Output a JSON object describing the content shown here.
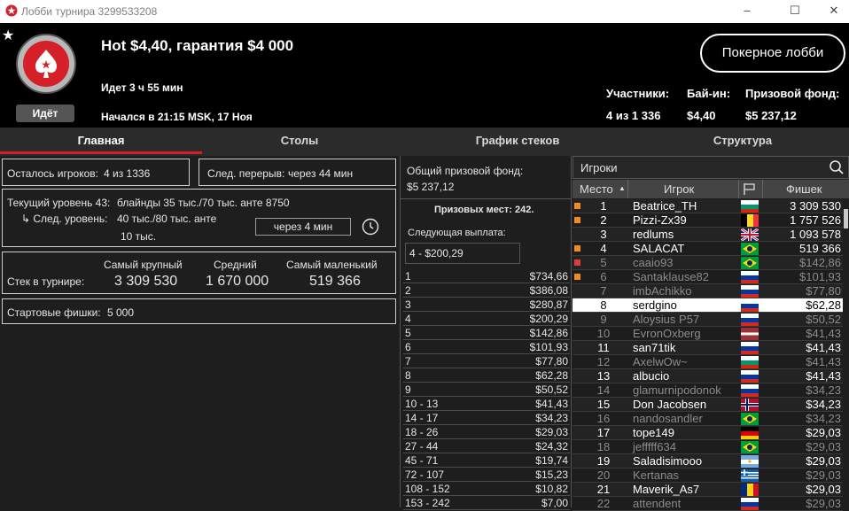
{
  "window": {
    "title": "Лобби турнира 3299533208",
    "minimize": "–",
    "maximize": "☐",
    "close": "✕"
  },
  "header": {
    "favorite_icon": "★",
    "tournament_name": "Hot $4,40, гарантия $4 000",
    "status": "Идёт",
    "running_time": "Идет 3 ч 55 мин",
    "started": "Начался в 21:15 MSK, 17 Ноя",
    "poker_lobby_button": "Покерное лобби",
    "stats": {
      "participants_label": "Участники:",
      "participants_value": "4 из 1 336",
      "buyin_label": "Бай-ин:",
      "buyin_value": "$4,40",
      "prize_label": "Призовой фонд:",
      "prize_value": "$5 237,12"
    }
  },
  "tabs": [
    "Главная",
    "Столы",
    "График стеков",
    "Структура"
  ],
  "info": {
    "players_left_label": "Осталось игроков:",
    "players_left_value": "4 из 1336",
    "next_break_label": "След. перерыв:",
    "next_break_value": "через 44 мин",
    "current_level_label": "Текущий уровень 43:",
    "current_level_value": "блайнды 35 тыс./70 тыс. анте 8750",
    "next_level_label": "↳  След. уровень:",
    "next_level_value_1": "40 тыс./80 тыс. анте",
    "next_level_value_2": "10 тыс.",
    "next_level_in": "через 4 мин",
    "stack_label": "Стек в турнире:",
    "largest_label": "Самый крупный",
    "largest_value": "3 309 530",
    "average_label": "Средний",
    "average_value": "1 670 000",
    "smallest_label": "Самый маленький",
    "smallest_value": "519 366",
    "starting_chips_label": "Стартовые фишки:",
    "starting_chips_value": "5 000"
  },
  "prize": {
    "pool_label": "Общий призовой фонд:",
    "pool_value": "$5 237,12",
    "places_label": "Призовых мест: 242.",
    "next_payout_label": "Следующая выплата:",
    "next_payout_value": "4 - $200,29",
    "payouts": [
      {
        "place": "1",
        "amount": "$734,66"
      },
      {
        "place": "2",
        "amount": "$386,08"
      },
      {
        "place": "3",
        "amount": "$280,87"
      },
      {
        "place": "4",
        "amount": "$200,29"
      },
      {
        "place": "5",
        "amount": "$142,86"
      },
      {
        "place": "6",
        "amount": "$101,93"
      },
      {
        "place": "7",
        "amount": "$77,80"
      },
      {
        "place": "8",
        "amount": "$62,28"
      },
      {
        "place": "9",
        "amount": "$50,52"
      },
      {
        "place": "10 - 13",
        "amount": "$41,43"
      },
      {
        "place": "14 - 17",
        "amount": "$34,23"
      },
      {
        "place": "18 - 26",
        "amount": "$29,03"
      },
      {
        "place": "27 - 44",
        "amount": "$24,32"
      },
      {
        "place": "45 - 71",
        "amount": "$19,74"
      },
      {
        "place": "72 - 107",
        "amount": "$15,23"
      },
      {
        "place": "108 - 152",
        "amount": "$10,82"
      },
      {
        "place": "153 - 242",
        "amount": "$7,00"
      }
    ]
  },
  "players": {
    "search_label": "Игроки",
    "col_place": "Место",
    "col_player": "Игрок",
    "col_chips": "Фишек",
    "sort_icon": "▲",
    "flag_col_icon": "flag-icon",
    "rows": [
      {
        "rank": "1",
        "name": "Beatrice_TH",
        "chips": "3 309 530",
        "flag": "bg",
        "marker": "#f08a24",
        "active": true
      },
      {
        "rank": "2",
        "name": "Pizzi-Zx39",
        "chips": "1 757 526",
        "flag": "be",
        "marker": "#f08a24",
        "active": true
      },
      {
        "rank": "3",
        "name": "redlums",
        "chips": "1 093 578",
        "flag": "gb",
        "marker": "",
        "active": true
      },
      {
        "rank": "4",
        "name": "SALACAT",
        "chips": "519 366",
        "flag": "br",
        "marker": "#f08a24",
        "active": true
      },
      {
        "rank": "5",
        "name": "caaio93",
        "chips": "$142,86",
        "flag": "br",
        "marker": "#e03c3c",
        "active": false
      },
      {
        "rank": "6",
        "name": "Santaklause82",
        "chips": "$101,93",
        "flag": "ru",
        "marker": "#f08a24",
        "active": false
      },
      {
        "rank": "7",
        "name": "imbAchikko",
        "chips": "$77,80",
        "flag": "ru",
        "marker": "",
        "active": false
      },
      {
        "rank": "8",
        "name": "serdgino",
        "chips": "$62,28",
        "flag": "ru",
        "marker": "",
        "active": true,
        "highlight": true
      },
      {
        "rank": "9",
        "name": "Aloysius P57",
        "chips": "$50,52",
        "flag": "ru",
        "marker": "",
        "active": false
      },
      {
        "rank": "10",
        "name": "EvronOxberg",
        "chips": "$41,43",
        "flag": "lv",
        "marker": "",
        "active": false
      },
      {
        "rank": "11",
        "name": "san71tik",
        "chips": "$41,43",
        "flag": "ru",
        "marker": "",
        "active": true
      },
      {
        "rank": "12",
        "name": "AxelwOw~",
        "chips": "$41,43",
        "flag": "bg",
        "marker": "",
        "active": false
      },
      {
        "rank": "13",
        "name": "albucio",
        "chips": "$41,43",
        "flag": "ru",
        "marker": "",
        "active": true
      },
      {
        "rank": "14",
        "name": "glamurnipodonok",
        "chips": "$34,23",
        "flag": "ru",
        "marker": "",
        "active": false
      },
      {
        "rank": "15",
        "name": "Don Jacobsen",
        "chips": "$34,23",
        "flag": "no",
        "marker": "",
        "active": true
      },
      {
        "rank": "16",
        "name": "nandosandler",
        "chips": "$34,23",
        "flag": "br",
        "marker": "",
        "active": false
      },
      {
        "rank": "17",
        "name": "tope149",
        "chips": "$29,03",
        "flag": "de",
        "marker": "",
        "active": true
      },
      {
        "rank": "18",
        "name": "jefffff634",
        "chips": "$29,03",
        "flag": "br",
        "marker": "",
        "active": false
      },
      {
        "rank": "19",
        "name": "Saladisimooo",
        "chips": "$29,03",
        "flag": "ar",
        "marker": "",
        "active": true
      },
      {
        "rank": "20",
        "name": "Kertanas",
        "chips": "$29,03",
        "flag": "gr",
        "marker": "",
        "active": false
      },
      {
        "rank": "21",
        "name": "Maverik_As7",
        "chips": "$29,03",
        "flag": "ro",
        "marker": "",
        "active": true
      },
      {
        "rank": "22",
        "name": "attendent",
        "chips": "$29,03",
        "flag": "ru",
        "marker": "",
        "active": false
      }
    ]
  }
}
